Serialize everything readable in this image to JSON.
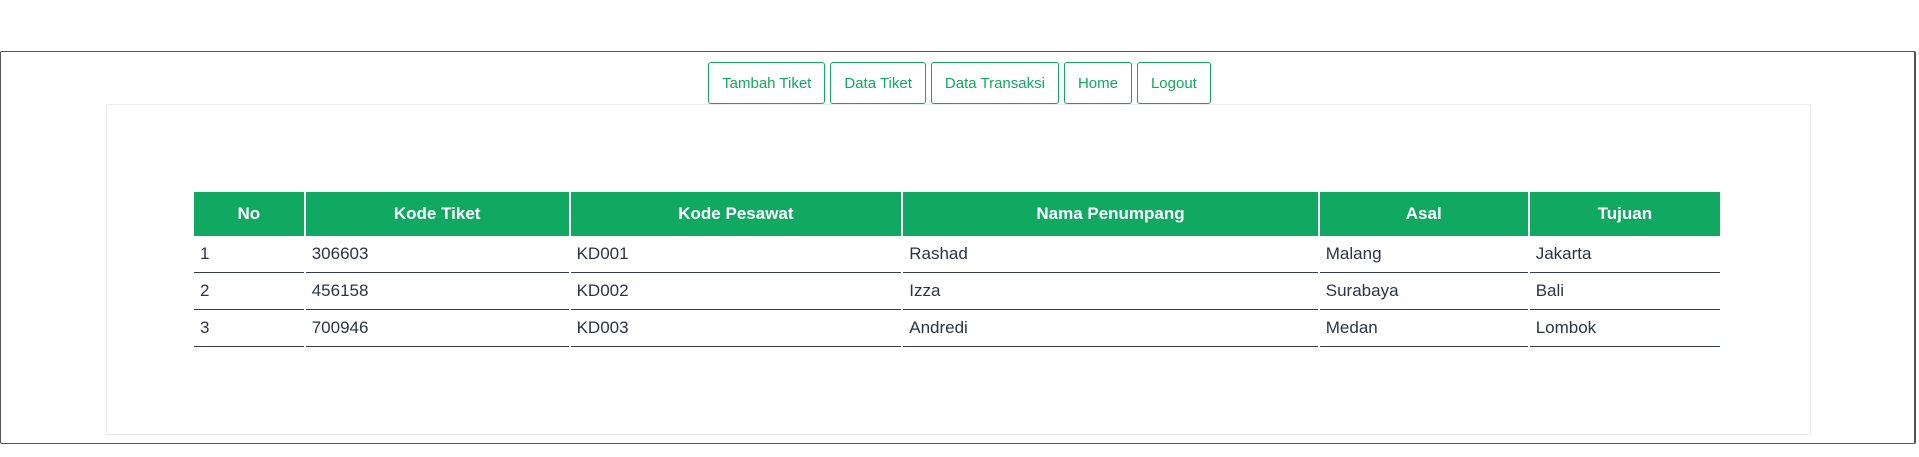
{
  "nav": {
    "items": [
      {
        "label": "Tambah Tiket",
        "name": "nav-tambah-tiket-button"
      },
      {
        "label": "Data Tiket",
        "name": "nav-data-tiket-button"
      },
      {
        "label": "Data Transaksi",
        "name": "nav-data-transaksi-button"
      },
      {
        "label": "Home",
        "name": "nav-home-button"
      },
      {
        "label": "Logout",
        "name": "nav-logout-button"
      }
    ]
  },
  "table": {
    "headers": [
      "No",
      "Kode Tiket",
      "Kode Pesawat",
      "Nama Penumpang",
      "Asal",
      "Tujuan"
    ],
    "rows": [
      [
        "1",
        "306603",
        "KD001",
        "Rashad",
        "Malang",
        "Jakarta"
      ],
      [
        "2",
        "456158",
        "KD002",
        "Izza",
        "Surabaya",
        "Bali"
      ],
      [
        "3",
        "700946",
        "KD003",
        "Andredi",
        "Medan",
        "Lombok"
      ]
    ]
  },
  "colors": {
    "accent": "#11a861",
    "text": "#2d3344",
    "border": "#555555"
  }
}
